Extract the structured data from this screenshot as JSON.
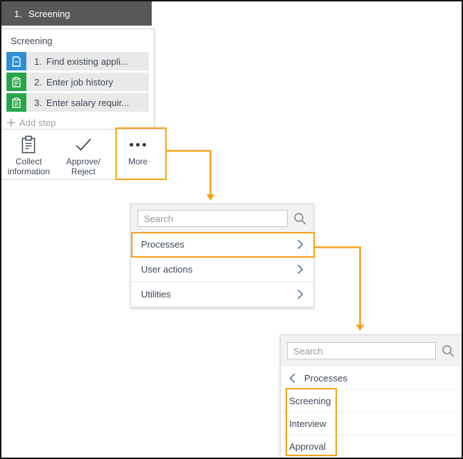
{
  "colors": {
    "annotation_orange": "#F5A31D",
    "case_header_bg": "#58585A",
    "step_icon_blue": "#2E8FD2",
    "step_icon_green": "#2AA64A"
  },
  "case_header": {
    "number": "1.",
    "title": "Screening"
  },
  "steps_panel": {
    "title": "Screening",
    "steps": [
      {
        "number": "1.",
        "label": "Find existing appli...",
        "icon": "document-icon"
      },
      {
        "number": "2.",
        "label": "Enter job history",
        "icon": "clipboard-icon"
      },
      {
        "number": "3.",
        "label": "Enter salary requir...",
        "icon": "clipboard-icon"
      }
    ],
    "add_step_label": "Add step"
  },
  "toolbar": {
    "buttons": [
      {
        "icon": "clipboard-icon",
        "line1": "Collect",
        "line2": "information"
      },
      {
        "icon": "check-icon",
        "line1": "Approve/",
        "line2": "Reject"
      },
      {
        "icon": "ellipsis-icon",
        "line1": "More",
        "line2": ""
      }
    ]
  },
  "step_type_menu": {
    "search_placeholder": "Search",
    "items": [
      {
        "label": "Processes"
      },
      {
        "label": "User actions"
      },
      {
        "label": "Utilities"
      }
    ]
  },
  "processes_submenu": {
    "search_placeholder": "Search",
    "back_label": "Processes",
    "items": [
      {
        "label": "Screening"
      },
      {
        "label": "Interview"
      },
      {
        "label": "Approval"
      }
    ]
  }
}
